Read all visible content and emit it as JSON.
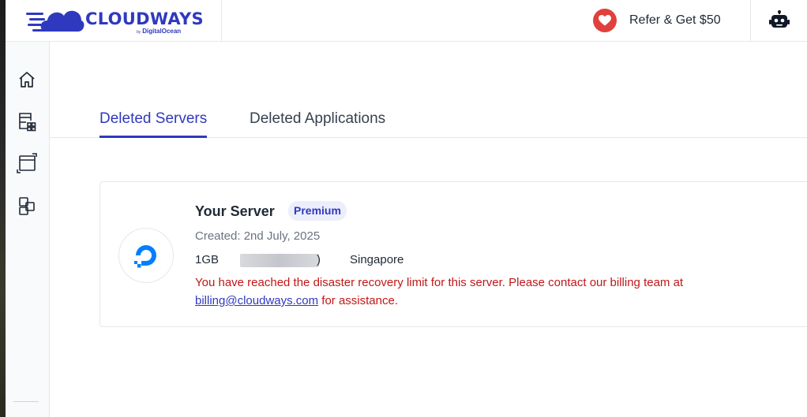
{
  "brand": {
    "name": "CLOUDWAYS",
    "by": "by",
    "sub": "DigitalOcean",
    "color": "#2f39bf"
  },
  "header": {
    "refer_label": "Refer & Get $50",
    "refer_icon": "heart-icon",
    "assistant_icon": "robot-icon"
  },
  "sidebar": {
    "items": [
      {
        "icon": "home-icon"
      },
      {
        "icon": "servers-icon"
      },
      {
        "icon": "applications-icon"
      },
      {
        "icon": "projects-icon"
      }
    ]
  },
  "tabs": [
    {
      "label": "Deleted Servers",
      "active": true
    },
    {
      "label": "Deleted Applications",
      "active": false
    }
  ],
  "server": {
    "name": "Your Server",
    "badge": "Premium",
    "created": "Created: 2nd July, 2025",
    "size": "1GB",
    "paren": ")",
    "location": "Singapore",
    "provider_icon": "digitalocean-icon",
    "warning_prefix": "You have reached the disaster recovery limit for this server. Please contact our billing team at ",
    "warning_email": "billing@cloudways.com",
    "warning_suffix": " for assistance."
  },
  "colors": {
    "accent": "#2f39bf",
    "error": "#c01818",
    "heart": "#e0413c"
  }
}
